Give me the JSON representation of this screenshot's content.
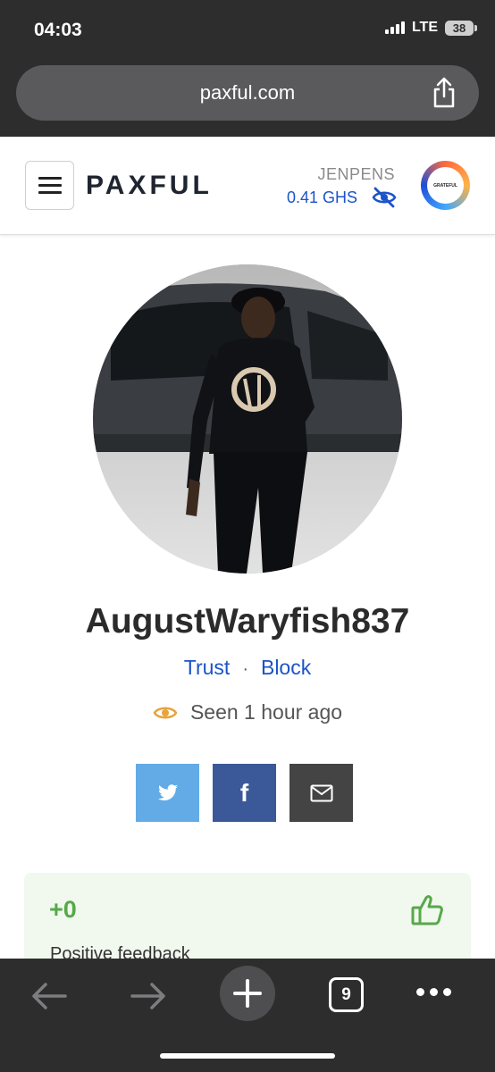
{
  "status_bar": {
    "time": "04:03",
    "network": "LTE",
    "battery": "38"
  },
  "browser": {
    "url": "paxful.com",
    "open_tabs": "9"
  },
  "header": {
    "logo": "PAXFUL",
    "user_name": "JENPENS",
    "balance": "0.41 GHS",
    "avatar_text": "GRATEFUL"
  },
  "profile": {
    "username": "AugustWaryfish837",
    "trust_label": "Trust",
    "separator": "·",
    "block_label": "Block",
    "seen_text": "Seen 1 hour ago"
  },
  "share": {
    "facebook_label": "f"
  },
  "feedback": {
    "count": "+0",
    "label": "Positive feedback"
  },
  "colors": {
    "link_blue": "#1b53c8",
    "positive_green": "#57a94a",
    "twitter": "#62abe6",
    "facebook": "#3b5998",
    "email": "#444444",
    "eye_orange": "#e8a33d",
    "browser_chrome": "#2d2d2e"
  }
}
